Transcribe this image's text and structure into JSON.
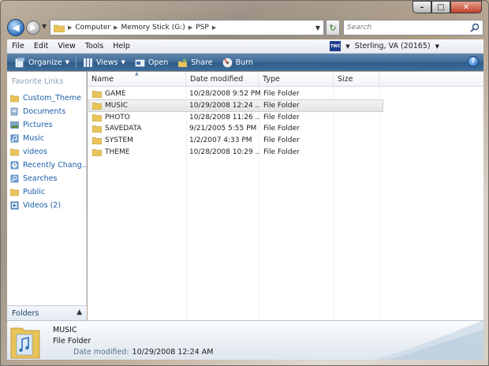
{
  "window": {
    "caption_min": "–",
    "caption_max": "□",
    "caption_close": "✕"
  },
  "nav": {
    "back_icon": "arrow-left-icon",
    "forward_icon": "arrow-right-icon",
    "breadcrumbs": [
      "Computer",
      "Memory Stick (G:)",
      "PSP"
    ],
    "search_placeholder": "Search"
  },
  "menubar": {
    "items": [
      "File",
      "Edit",
      "View",
      "Tools",
      "Help"
    ],
    "weather_logo": "TWC",
    "weather_location": "Sterling, VA (20165)"
  },
  "toolbar": {
    "organize": "Organize",
    "views": "Views",
    "open": "Open",
    "share": "Share",
    "burn": "Burn",
    "help": "?"
  },
  "navpane": {
    "title": "Favorite Links",
    "items": [
      {
        "label": "Custom_Theme",
        "icon": "folder-icon"
      },
      {
        "label": "Documents",
        "icon": "documents-icon"
      },
      {
        "label": "Pictures",
        "icon": "pictures-icon"
      },
      {
        "label": "Music",
        "icon": "music-icon"
      },
      {
        "label": "videos",
        "icon": "folder-icon"
      },
      {
        "label": "Recently Chang...",
        "icon": "recent-icon"
      },
      {
        "label": "Searches",
        "icon": "search-folder-icon"
      },
      {
        "label": "Public",
        "icon": "folder-icon"
      },
      {
        "label": "Videos (2)",
        "icon": "videos-icon"
      }
    ],
    "folders_label": "Folders"
  },
  "filelist": {
    "columns": [
      "Name",
      "Date modified",
      "Type",
      "Size"
    ],
    "rows": [
      {
        "name": "GAME",
        "date": "10/28/2008 9:52 PM",
        "type": "File Folder",
        "size": ""
      },
      {
        "name": "MUSIC",
        "date": "10/29/2008 12:24 ...",
        "type": "File Folder",
        "size": "",
        "selected": true
      },
      {
        "name": "PHOTO",
        "date": "10/28/2008 11:26 ...",
        "type": "File Folder",
        "size": ""
      },
      {
        "name": "SAVEDATA",
        "date": "9/21/2005 5:55 PM",
        "type": "File Folder",
        "size": ""
      },
      {
        "name": "SYSTEM",
        "date": "1/2/2007 4:33 PM",
        "type": "File Folder",
        "size": ""
      },
      {
        "name": "THEME",
        "date": "10/28/2008 10:29 ...",
        "type": "File Folder",
        "size": ""
      }
    ]
  },
  "details": {
    "name": "MUSIC",
    "type": "File Folder",
    "modified_label": "Date modified:",
    "modified_value": "10/29/2008 12:24 AM"
  },
  "colors": {
    "toolbar_blue": "#3e6a96",
    "link_blue": "#1a5ea8",
    "folder_yellow": "#e8c45a"
  }
}
